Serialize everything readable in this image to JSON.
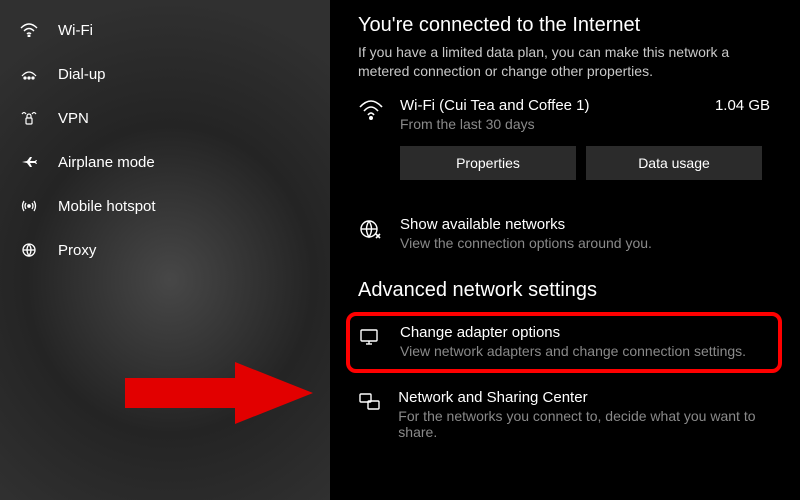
{
  "sidebar": {
    "items": [
      {
        "label": "Wi-Fi"
      },
      {
        "label": "Dial-up"
      },
      {
        "label": "VPN"
      },
      {
        "label": "Airplane mode"
      },
      {
        "label": "Mobile hotspot"
      },
      {
        "label": "Proxy"
      }
    ]
  },
  "main": {
    "status_title": "You're connected to the Internet",
    "status_sub": "If you have a limited data plan, you can make this network a metered connection or change other properties.",
    "connection": {
      "name": "Wi-Fi (Cui Tea and Coffee 1)",
      "sub": "From the last 30 days",
      "usage": "1.04 GB"
    },
    "buttons": {
      "properties": "Properties",
      "data_usage": "Data usage"
    },
    "show_networks": {
      "title": "Show available networks",
      "sub": "View the connection options around you."
    },
    "advanced_heading": "Advanced network settings",
    "adapter": {
      "title": "Change adapter options",
      "sub": "View network adapters and change connection settings."
    },
    "sharing": {
      "title": "Network and Sharing Center",
      "sub": "For the networks you connect to, decide what you want to share."
    }
  }
}
